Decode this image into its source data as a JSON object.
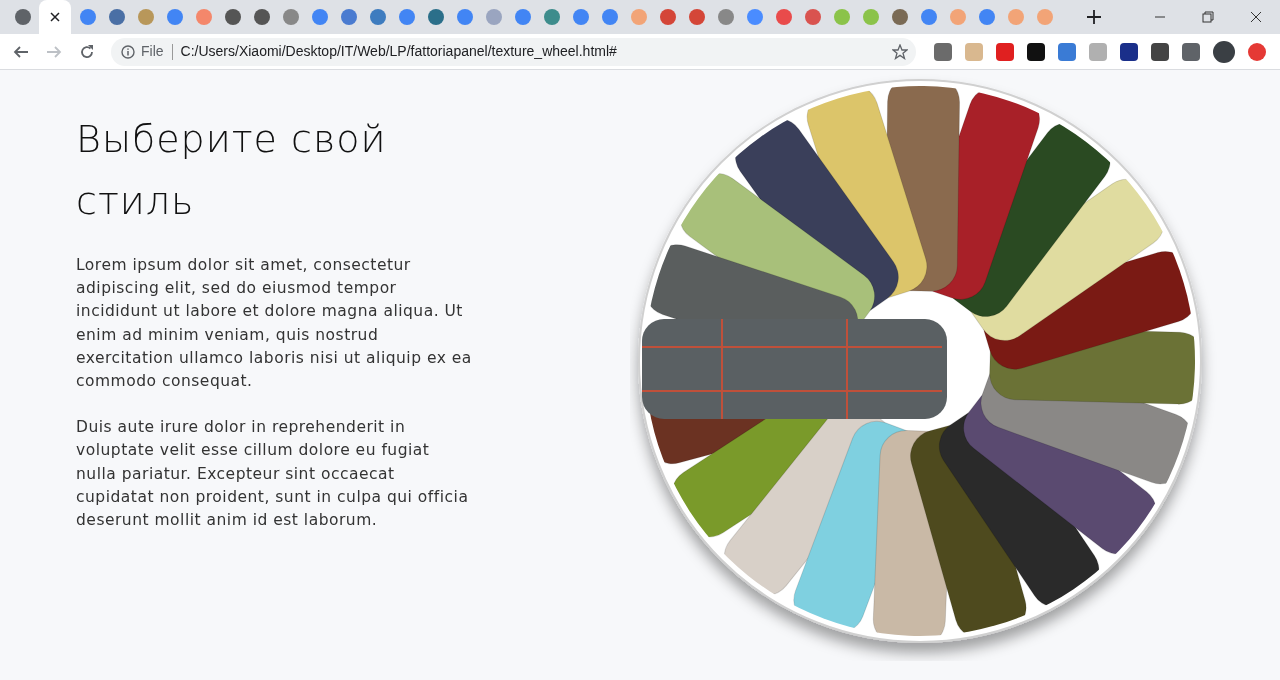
{
  "browser": {
    "tabs": [
      {
        "selected": false,
        "color": "#5f6368"
      },
      {
        "selected": true
      },
      {
        "selected": false,
        "color": "#4285f4"
      },
      {
        "selected": false,
        "color": "#4a6fa5"
      },
      {
        "selected": false,
        "color": "#b8975a"
      },
      {
        "selected": false,
        "color": "#4285f4"
      },
      {
        "selected": false,
        "color": "#f4876b"
      },
      {
        "selected": false,
        "color": "#555555"
      },
      {
        "selected": false,
        "color": "#555555"
      },
      {
        "selected": false,
        "color": "#888888"
      },
      {
        "selected": false,
        "color": "#4285f4"
      },
      {
        "selected": false,
        "color": "#4a7bd0"
      },
      {
        "selected": false,
        "color": "#3e7cbf"
      },
      {
        "selected": false,
        "color": "#4285f4"
      },
      {
        "selected": false,
        "color": "#2b6f8a"
      },
      {
        "selected": false,
        "color": "#4285f4"
      },
      {
        "selected": false,
        "color": "#9aa5c0"
      },
      {
        "selected": false,
        "color": "#4285f4"
      },
      {
        "selected": false,
        "color": "#3d8c8c"
      },
      {
        "selected": false,
        "color": "#4285f4"
      },
      {
        "selected": false,
        "color": "#4285f4"
      },
      {
        "selected": false,
        "color": "#f2a477"
      },
      {
        "selected": false,
        "color": "#d44638"
      },
      {
        "selected": false,
        "color": "#d44638"
      },
      {
        "selected": false,
        "color": "#888888"
      },
      {
        "selected": false,
        "color": "#4a8cff"
      },
      {
        "selected": false,
        "color": "#e94b4b"
      },
      {
        "selected": false,
        "color": "#d9534f"
      },
      {
        "selected": false,
        "color": "#8bc34a"
      },
      {
        "selected": false,
        "color": "#8bc34a"
      },
      {
        "selected": false,
        "color": "#7a6a55"
      },
      {
        "selected": false,
        "color": "#4285f4"
      },
      {
        "selected": false,
        "color": "#f2a477"
      },
      {
        "selected": false,
        "color": "#4285f4"
      },
      {
        "selected": false,
        "color": "#f2a477"
      },
      {
        "selected": false,
        "color": "#f2a477"
      }
    ],
    "nav_buttons": [
      {
        "kind": "back",
        "disabled": false
      },
      {
        "kind": "forward",
        "disabled": true
      },
      {
        "kind": "reload",
        "disabled": false
      }
    ],
    "address_bar": {
      "scheme_label": "File",
      "url": "C:/Users/Xiaomi/Desktop/IT/Web/LP/fattoriapanel/texture_wheel.html#"
    },
    "extensions": [
      {
        "color": "#6b6b6b"
      },
      {
        "color": "#d9b88f"
      },
      {
        "color": "#e02020"
      },
      {
        "color": "#111111"
      },
      {
        "color": "#3a7bd5"
      },
      {
        "color": "#b0b0b0"
      },
      {
        "color": "#1a2f8a"
      },
      {
        "color": "#444444"
      },
      {
        "color": "#5f6368"
      },
      {
        "color": "#3a3f44"
      },
      {
        "color": "#e53935"
      }
    ]
  },
  "page": {
    "heading": "Выберите свой стиль",
    "paragraphs": [
      "Lorem ipsum dolor sit amet, consectetur adipiscing elit, sed do eiusmod tempor incididunt ut labore et dolore magna aliqua. Ut enim ad minim veniam, quis nostrud exercitation ullamco laboris nisi ut aliquip ex ea commodo consequat.",
      "Duis aute irure dolor in reprehenderit in voluptate velit esse cillum dolore eu fugiat nulla pariatur. Excepteur sint occaecat cupidatat non proident, sunt in culpa qui officia deserunt mollit anim id est laborum."
    ]
  }
}
